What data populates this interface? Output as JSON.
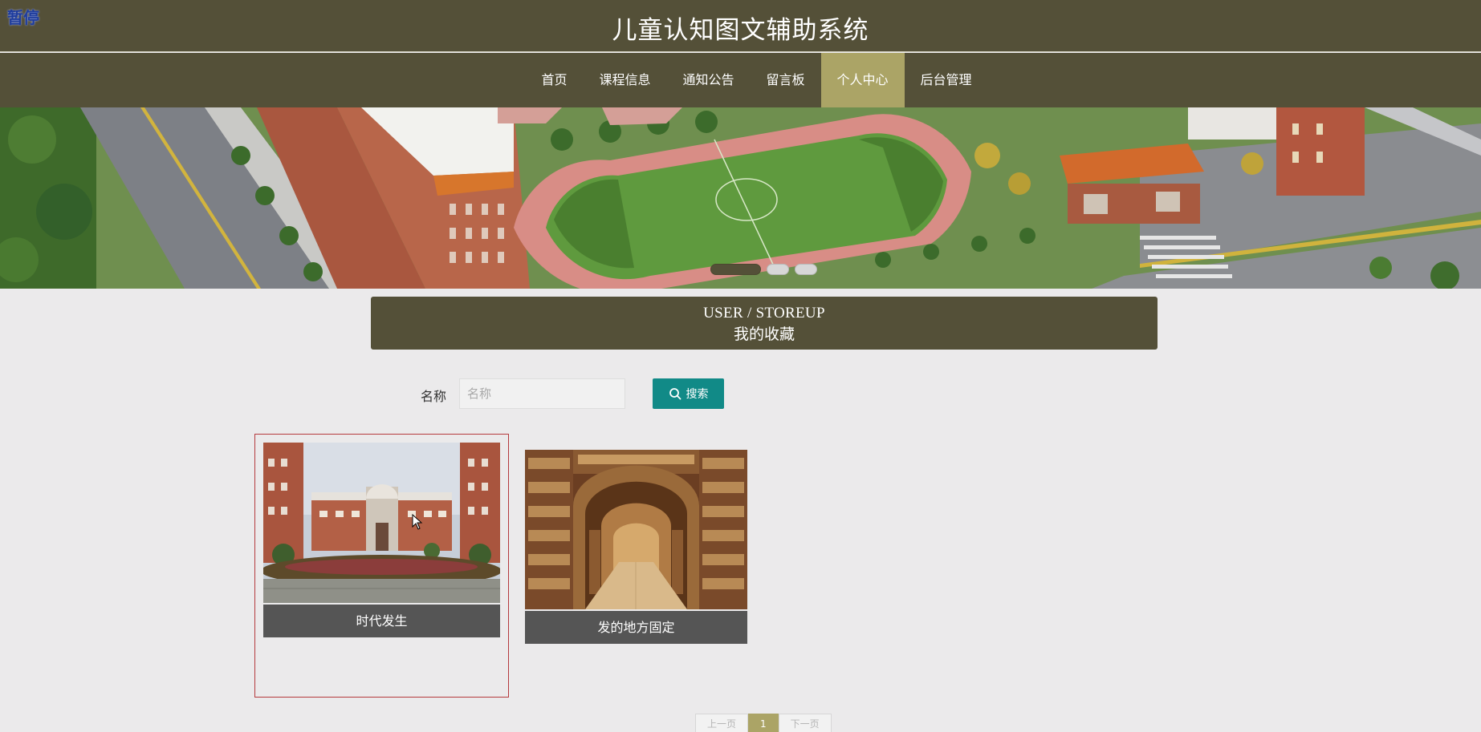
{
  "overlay": {
    "pause_label": "暂停"
  },
  "header": {
    "site_title": "儿童认知图文辅助系统"
  },
  "nav": {
    "items": [
      {
        "label": "首页",
        "active": false
      },
      {
        "label": "课程信息",
        "active": false
      },
      {
        "label": "通知公告",
        "active": false
      },
      {
        "label": "留言板",
        "active": false
      },
      {
        "label": "个人中心",
        "active": true
      },
      {
        "label": "后台管理",
        "active": false
      }
    ]
  },
  "banner": {
    "slide_count": 3,
    "active_slide": 1
  },
  "section": {
    "title_en": "USER / STOREUP",
    "title_cn": "我的收藏"
  },
  "search": {
    "label": "名称",
    "placeholder": "名称",
    "value": "",
    "button_label": "搜索"
  },
  "cards": [
    {
      "caption": "时代发生",
      "image": "school-campus-photo",
      "hovered": true
    },
    {
      "caption": "发的地方固定",
      "image": "library-bookshelves-photo",
      "hovered": false
    }
  ],
  "pagination": {
    "prev_label": "上一页",
    "current_page": "1",
    "next_label": "下一页"
  },
  "colors": {
    "header_bg": "#545038",
    "nav_active_bg": "#aba466",
    "search_button": "#118a87",
    "caption_bg": "#555555",
    "hover_border": "#b53a3d",
    "page_bg": "#ebeaeb"
  },
  "icons": {
    "search_button_icon": "search-icon"
  }
}
